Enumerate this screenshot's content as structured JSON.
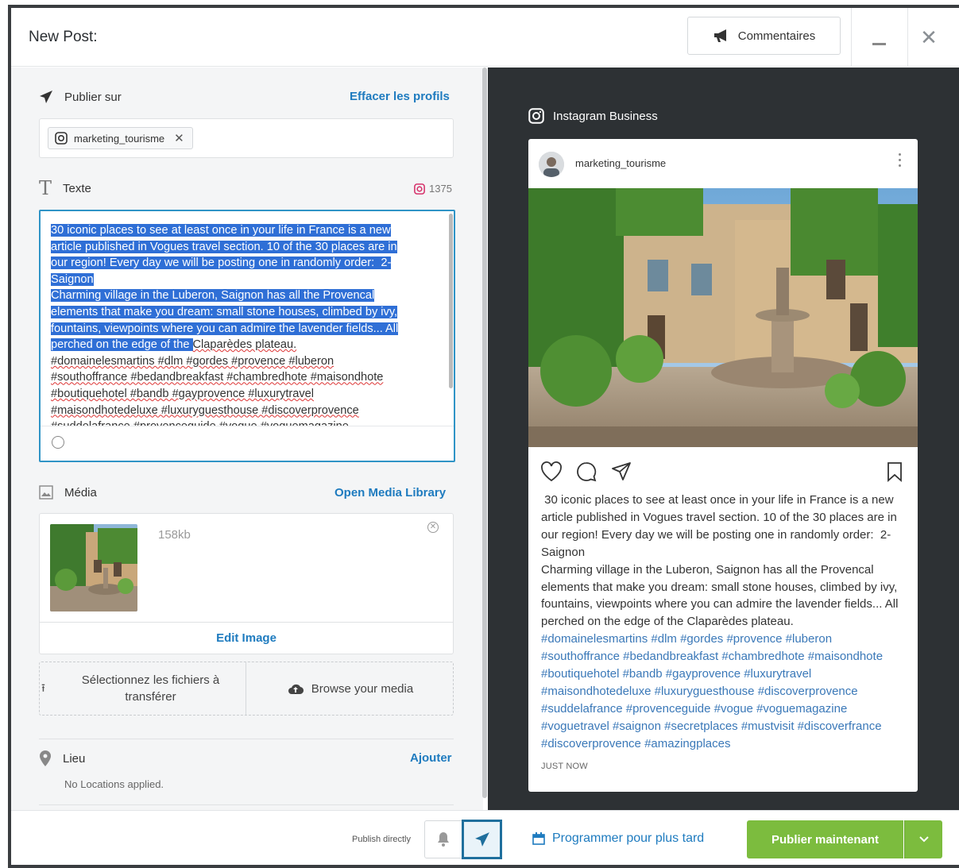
{
  "header": {
    "title": "New Post:",
    "comments_label": "Commentaires"
  },
  "publish_on": {
    "label": "Publier sur",
    "clear_link": "Effacer les profils",
    "profile": "marketing_tourisme"
  },
  "text": {
    "label": "Texte",
    "counter": "1375",
    "selected": "30 iconic places to see at least once in your life in France is a new\narticle published in Vogues travel section. 10 of the 30 places are in\nour region! Every day we will be posting one in randomly order:  2-\nSaignon\nCharming village in the Luberon, Saignon has all the Provencal\nelements that make you dream: small stone houses, climbed by ivy,\nfountains, viewpoints where you can admire the lavender fields... All\nperched on the edge of the ",
    "unselected": "Claparèdes plateau.\n#domainelesmartins #dlm #gordes #provence #luberon\n#southoffrance #bedandbreakfast #chambredhote #maisondhote\n#boutiquehotel #bandb #gayprovence #luxurytravel\n#maisondhotedeluxe #luxuryguesthouse #discoverprovence\n#suddelafrance #provenceguide #vogue #voguemagazine"
  },
  "media": {
    "label": "Média",
    "library_link": "Open Media Library",
    "file_size": "158kb",
    "edit_label": "Edit Image",
    "upload_label": "Sélectionnez les fichiers à transférer",
    "browse_label": "Browse your media"
  },
  "location": {
    "label": "Lieu",
    "add_link": "Ajouter",
    "empty_text": "No Locations applied."
  },
  "preview": {
    "network_label": "Instagram Business",
    "username": "marketing_tourisme",
    "caption": " 30 iconic places to see at least once in your life in France is a new article published in Vogues travel section. 10 of the 30 places are in our region! Every day we will be posting one in randomly order:  2- Saignon\nCharming village in the Luberon, Saignon has all the Provencal elements that make you dream: small stone houses, climbed by ivy, fountains, viewpoints where you can admire the lavender fields... All perched on the edge of the Claparèdes plateau.",
    "hashtags": "#domainelesmartins #dlm #gordes #provence #luberon #southoffrance #bedandbreakfast #chambredhote #maisondhote #boutiquehotel #bandb #gayprovence #luxurytravel #maisondhotedeluxe #luxuryguesthouse #discoverprovence #suddelafrance #provenceguide #vogue #voguemagazine #voguetravel #saignon #secretplaces #mustvisit #discoverfrance #discoverprovence #amazingplaces",
    "timestamp": "JUST NOW"
  },
  "footer": {
    "publish_directly": "Publish directly",
    "schedule_label": "Programmer pour plus tard",
    "publish_now": "Publier maintenant"
  },
  "colors": {
    "accent_blue": "#1e7bbf",
    "publish_green": "#7cbc3e",
    "preview_bg": "#2d3134",
    "selection": "#2f6fd6"
  }
}
